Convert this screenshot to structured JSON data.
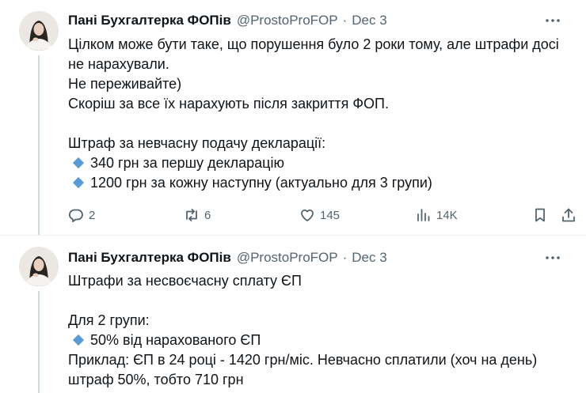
{
  "tweets": [
    {
      "author": "Пані Бухгалтерка ФОПів",
      "handle": "@ProstoProFOP",
      "separator": "·",
      "date": "Dec 3",
      "lines": [
        "Цілком може бути таке, що порушення було 2 роки тому, але штрафи досі",
        "не нарахували.",
        "Не переживайте)",
        "Скоріш за все їх нарахують після закриття ФОП.",
        "",
        "Штраф за невчасну подачу декларації:",
        "340 грн за першу декларацію",
        "1200 грн за кожну наступну (актуально для 3 групи)"
      ],
      "bullet_lines": [
        6,
        7
      ],
      "actions": {
        "replies": "2",
        "reposts": "6",
        "likes": "145",
        "views": "14K"
      }
    },
    {
      "author": "Пані Бухгалтерка ФОПів",
      "handle": "@ProstoProFOP",
      "separator": "·",
      "date": "Dec 3",
      "lines": [
        "Штрафи за несвоєчасну сплату ЄП",
        "",
        "Для 2 групи:",
        "50% від нарахованого ЄП",
        "Приклад: ЄП в 24 році - 1420 грн/міс. Невчасно сплатили (хоч на день)",
        "штраф 50%, тобто 710 грн"
      ],
      "bullet_lines": [
        3
      ]
    }
  ],
  "icons": {
    "more": "more-horizontal-icon",
    "reply": "reply-icon",
    "repost": "repost-icon",
    "like": "heart-icon",
    "views": "views-chart-icon",
    "bookmark": "bookmark-icon",
    "share": "share-icon",
    "bullet": "small-blue-diamond-icon"
  },
  "colors": {
    "text": "#0f1419",
    "secondary": "#536471",
    "bullet": "#5b9bd5",
    "thread_line": "#cfd9de"
  }
}
